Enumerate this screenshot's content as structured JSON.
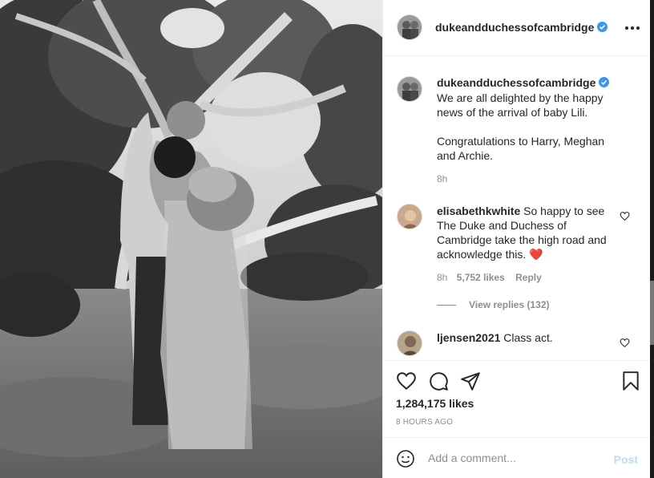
{
  "post": {
    "author": "dukeandduchessofcambridge",
    "verified": true,
    "photo_alt": "Black and white family photo under a tree"
  },
  "caption": {
    "username": "dukeandduchessofcambridge",
    "lines": [
      "We are all delighted by the happy news of the arrival of baby Lili.",
      "Congratulations to Harry, Meghan and Archie."
    ],
    "time": "8h"
  },
  "comments": [
    {
      "username": "elisabethkwhite",
      "text": "So happy to see The Duke and Duchess of Cambridge take the high road and acknowledge this. ❤️",
      "time": "8h",
      "likes": "5,752 likes",
      "reply_label": "Reply",
      "view_replies": "View replies (132)"
    },
    {
      "username": "ljensen2021",
      "text": "Class act."
    }
  ],
  "likes_count": "1,284,175 likes",
  "posted_ago": "8 HOURS AGO",
  "add_comment": {
    "placeholder": "Add a comment...",
    "post_label": "Post"
  },
  "colors": {
    "accent": "#0095f6",
    "post_disabled": "#b2dffc",
    "heart": "#ed4956",
    "muted": "#8e8e8e"
  },
  "icons": [
    "like-icon",
    "comment-icon",
    "share-icon",
    "save-icon",
    "emoji-icon",
    "verified-icon",
    "more-icon"
  ]
}
